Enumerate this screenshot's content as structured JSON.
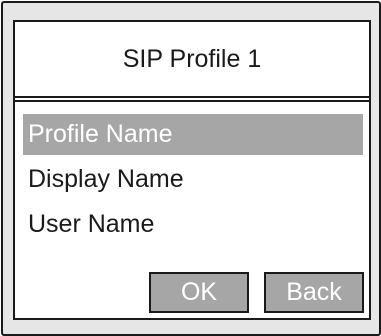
{
  "title": "SIP Profile 1",
  "menu": {
    "items": [
      {
        "label": "Profile Name",
        "selected": true
      },
      {
        "label": "Display Name",
        "selected": false
      },
      {
        "label": "User Name",
        "selected": false
      }
    ]
  },
  "buttons": {
    "ok_label": "OK",
    "back_label": "Back"
  },
  "colors": {
    "highlight": "#a6a6a6",
    "border": "#1a1a1a",
    "bezel": "#e6e6e6"
  }
}
